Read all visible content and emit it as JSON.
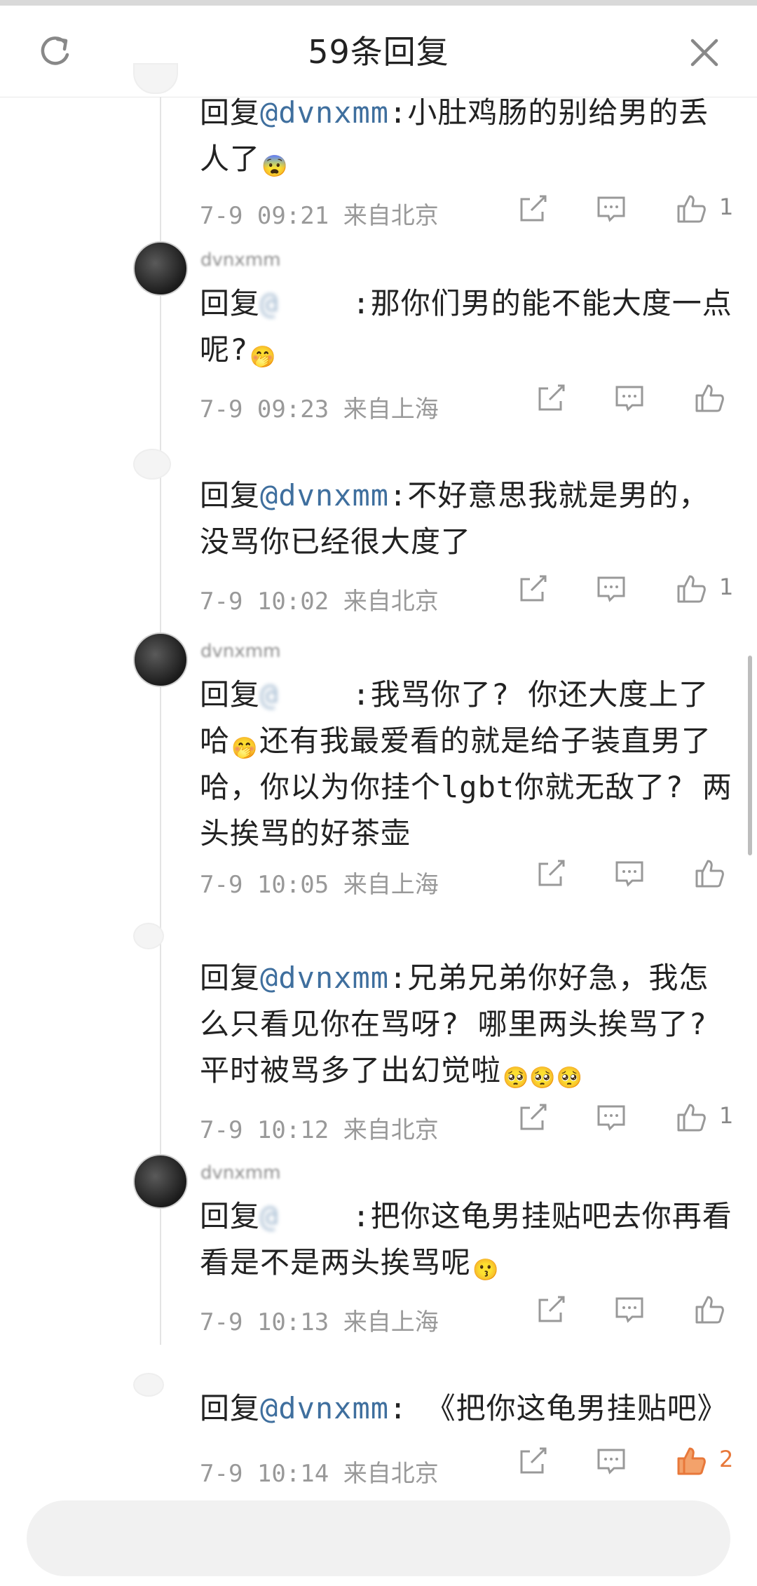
{
  "header": {
    "title": "59条回复",
    "refresh_icon": "refresh-icon",
    "close_icon": "close-icon"
  },
  "comments": [
    {
      "prefix": "回复",
      "mention": "@dvnxmm",
      "sep": ":",
      "text_before_emoji": "小肚鸡肠的别给男的丢人了",
      "emoji": "😨",
      "text_after_emoji": "",
      "time": "7-9 09:21",
      "location": "来自北京",
      "likes": "1"
    },
    {
      "username": "dvnxmm",
      "prefix": "回复",
      "mention": "@",
      "sep": ":",
      "text_before_emoji": "那你们男的能不能大度一点呢?",
      "emoji": "🤭",
      "text_after_emoji": "",
      "time": "7-9 09:23",
      "location": "来自上海",
      "likes": ""
    },
    {
      "prefix": "回复",
      "mention": "@dvnxmm",
      "sep": ":",
      "text_before_emoji": "不好意思我就是男的，没骂你已经很大度了",
      "emoji": "",
      "text_after_emoji": "",
      "time": "7-9 10:02",
      "location": "来自北京",
      "likes": "1"
    },
    {
      "username": "dvnxmm",
      "prefix": "回复",
      "mention": "@",
      "sep": ":",
      "text_before_emoji": "我骂你了? 你还大度上了哈",
      "emoji": "🤭",
      "text_after_emoji": "还有我最爱看的就是给子装直男了哈，你以为你挂个lgbt你就无敌了? 两头挨骂的好茶壶",
      "time": "7-9 10:05",
      "location": "来自上海",
      "likes": ""
    },
    {
      "prefix": "回复",
      "mention": "@dvnxmm",
      "sep": ":",
      "text_before_emoji": "兄弟兄弟你好急，我怎么只看见你在骂呀? 哪里两头挨骂了? 平时被骂多了出幻觉啦",
      "emoji": "🥺🥺🥺",
      "text_after_emoji": "",
      "time": "7-9 10:12",
      "location": "来自北京",
      "likes": "1"
    },
    {
      "username": "dvnxmm",
      "prefix": "回复",
      "mention": "@",
      "sep": ":",
      "text_before_emoji": "把你这龟男挂贴吧去你再看看是不是两头挨骂呢",
      "emoji": "😗",
      "text_after_emoji": "",
      "time": "7-9 10:13",
      "location": "来自上海",
      "likes": ""
    },
    {
      "prefix": "回复",
      "mention": "@dvnxmm",
      "sep": ":",
      "text_before_emoji": " 《把你这龟男挂贴吧》",
      "emoji": "",
      "text_after_emoji": "",
      "time": "7-9 10:14",
      "location": "来自北京",
      "likes": "2",
      "liked": true
    }
  ],
  "icons": {
    "share": "share-icon",
    "comment": "comment-icon",
    "like": "thumbs-up-icon"
  },
  "colors": {
    "mention": "#3f6f9e",
    "liked": "#e8783a",
    "meta": "#999999"
  }
}
